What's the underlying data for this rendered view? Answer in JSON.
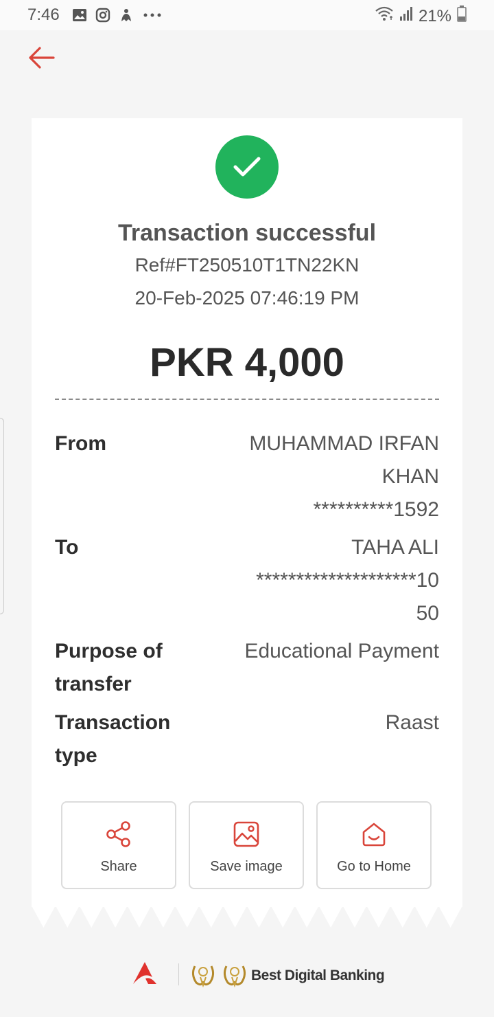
{
  "status_bar": {
    "time": "7:46",
    "icons": [
      "image-icon",
      "instagram-icon",
      "app-icon",
      "more-dots-icon"
    ],
    "battery": "21%"
  },
  "header": {
    "back_icon": "arrow-left-icon"
  },
  "receipt": {
    "status_icon": "checkmark-icon",
    "title": "Transaction successful",
    "reference": "Ref#FT250510T1TN22KN",
    "datetime": "20-Feb-2025 07:46:19 PM",
    "amount": "PKR 4,000",
    "rows": [
      {
        "label_lines": [
          "From"
        ],
        "value_lines": [
          "MUHAMMAD IRFAN",
          "KHAN",
          "**********1592"
        ]
      },
      {
        "label_lines": [
          "To"
        ],
        "value_lines": [
          "TAHA ALI",
          "********************10",
          "50"
        ]
      },
      {
        "label_lines": [
          "Purpose of",
          "transfer"
        ],
        "value_lines": [
          "Educational Payment"
        ]
      },
      {
        "label_lines": [
          "Transaction",
          "type"
        ],
        "value_lines": [
          "Raast"
        ]
      }
    ],
    "actions": [
      {
        "label": "Share",
        "icon": "share-icon"
      },
      {
        "label": "Save image",
        "icon": "save-image-icon"
      },
      {
        "label": "Go to Home",
        "icon": "home-icon"
      }
    ]
  },
  "footer": {
    "award_text": "Best Digital Banking"
  },
  "colors": {
    "accent_red": "#d9453a",
    "success_green": "#21b35c"
  }
}
